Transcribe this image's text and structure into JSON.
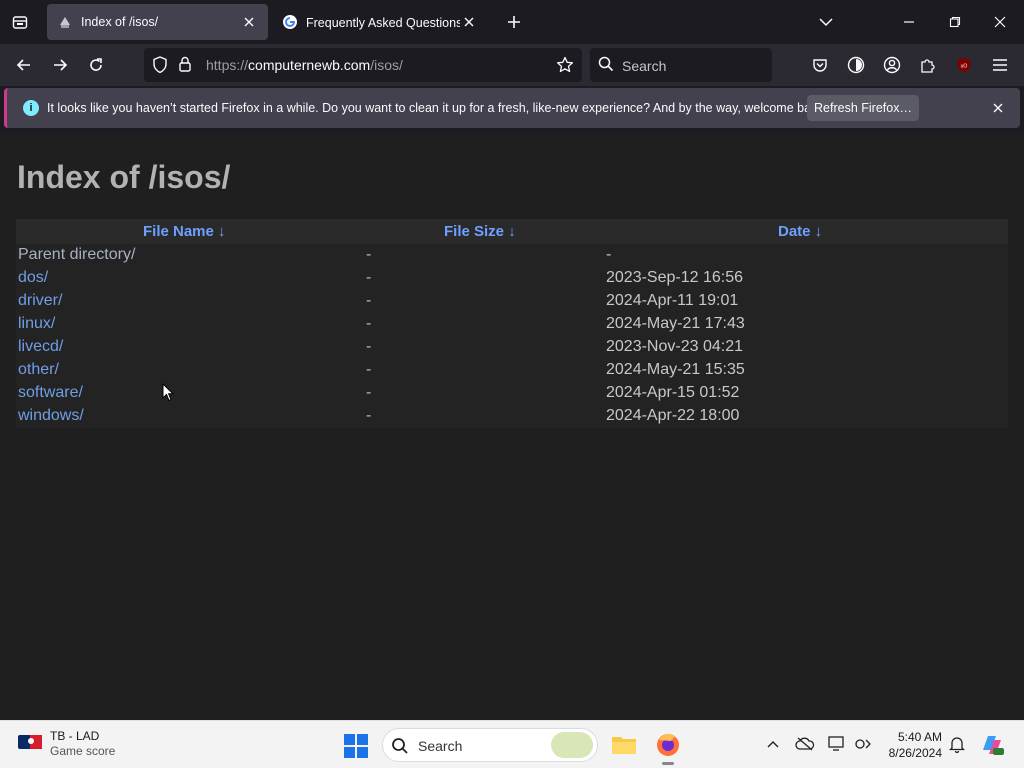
{
  "browser": {
    "tabs": [
      {
        "title": "Index of /isos/",
        "active": true,
        "favicon": "site-favicon"
      },
      {
        "title": "Frequently Asked Questions  |  ⋯",
        "active": false,
        "favicon": "google-g-icon"
      }
    ],
    "url": {
      "scheme": "https://",
      "host": "computernewb.com",
      "path": "/isos/"
    },
    "search_placeholder": "Search",
    "notification": {
      "message": "It looks like you haven’t started Firefox in a while. Do you want to clean it up for a fresh, like-new experience? And by the way, welcome back!",
      "button_label": "Refresh Firefox…"
    }
  },
  "page": {
    "title": "Index of /isos/",
    "columns": {
      "name": "File Name  ↓",
      "size": "File Size  ↓",
      "date": "Date  ↓"
    },
    "rows": [
      {
        "name": "Parent directory/",
        "size": "-",
        "date": "-"
      },
      {
        "name": "dos/",
        "size": "-",
        "date": "2023-Sep-12 16:56"
      },
      {
        "name": "driver/",
        "size": "-",
        "date": "2024-Apr-11 19:01"
      },
      {
        "name": "linux/",
        "size": "-",
        "date": "2024-May-21 17:43"
      },
      {
        "name": "livecd/",
        "size": "-",
        "date": "2023-Nov-23 04:21"
      },
      {
        "name": "other/",
        "size": "-",
        "date": "2024-May-21 15:35"
      },
      {
        "name": "software/",
        "size": "-",
        "date": "2024-Apr-15 01:52"
      },
      {
        "name": "windows/",
        "size": "-",
        "date": "2024-Apr-22 18:00"
      }
    ]
  },
  "taskbar": {
    "widget": {
      "title": "TB - LAD",
      "subtitle": "Game score"
    },
    "search_placeholder": "Search",
    "clock": {
      "time": "5:40 AM",
      "date": "8/26/2024"
    }
  },
  "colors": {
    "link": "#6e9fe6",
    "header": "#6ea0ff",
    "accent_bar": "#d03a8a"
  }
}
